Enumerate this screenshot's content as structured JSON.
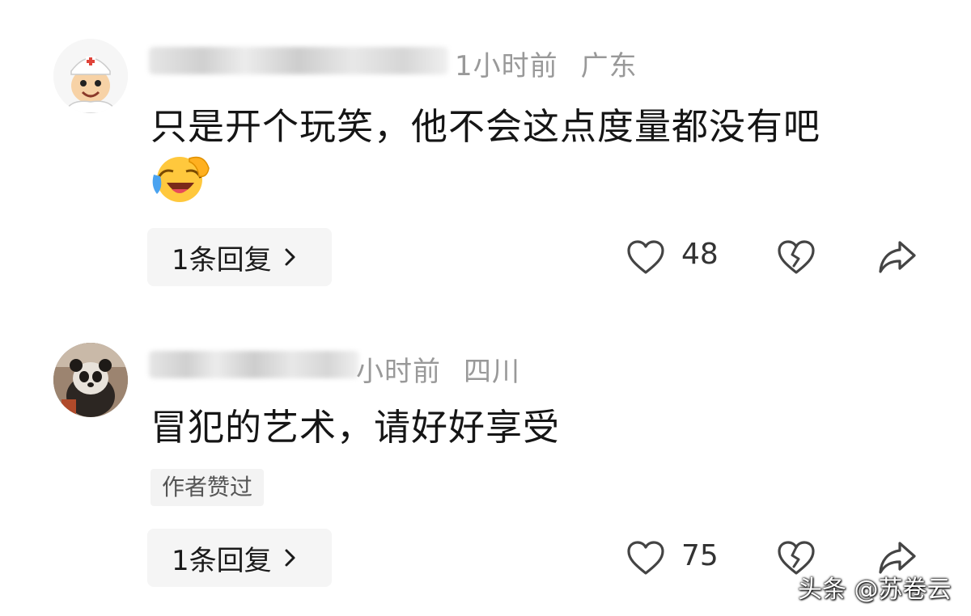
{
  "comments": [
    {
      "time": "1小时前",
      "location": "广东",
      "text": "只是开个玩笑，他不会这点度量都没有吧",
      "reply_label": "1条回复",
      "likes": "48",
      "avatar_icon": "cartoon-doctor-icon",
      "emoji_icon": "laughing-crying-emoji-icon"
    },
    {
      "time": "小时前",
      "location": "四川",
      "text": "冒犯的艺术，请好好享受",
      "badge": "作者赞过",
      "reply_label": "1条回复",
      "likes": "75",
      "avatar_icon": "panda-photo-icon"
    }
  ],
  "watermark": "头条 @苏卷云",
  "colors": {
    "meta": "#999999",
    "text": "#151515",
    "button_bg": "#f5f5f5",
    "icon": "#444444"
  }
}
